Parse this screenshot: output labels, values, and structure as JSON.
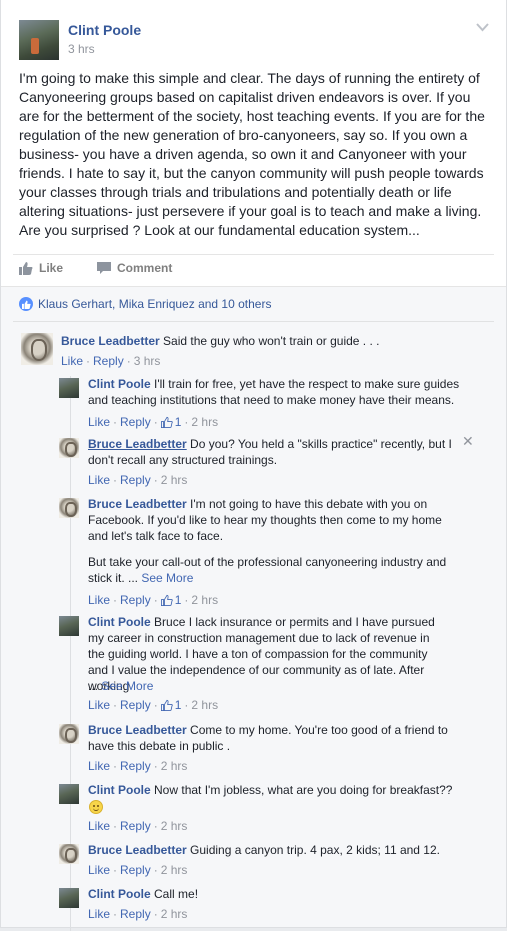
{
  "post": {
    "author": "Clint Poole",
    "time": "3 hrs",
    "text": "I'm going to make this simple and clear. The days of running the entirety of Canyoneering groups based on capitalist driven endeavors is over. If you are for the betterment of the society, host teaching events. If you are for the regulation of the new generation of bro-canyoneers, say so. If you own a business- you have a driven agenda, so own it and Canyoneer with your friends. I hate to say it, but the canyon community will push people towards your classes through trials and tribulations and potentially death or life altering situations- just persevere if your goal is to teach and make a living. Are you surprised ? Look at our fundamental education system..."
  },
  "actions": {
    "like": "Like",
    "comment": "Comment"
  },
  "likes_summary": "Klaus Gerhart, Mika Enriquez and 10 others",
  "labels": {
    "like": "Like",
    "reply": "Reply",
    "sep": "·",
    "see_more": "See More"
  },
  "comments": [
    {
      "name": "Bruce Leadbetter",
      "text": "Said the guy who won't train or guide . . .",
      "time": "3 hrs"
    },
    {
      "name": "Clint Poole",
      "text": "I'll train for free, yet have the respect to make sure guides and teaching institutions that need to make money have their means.",
      "likes": "1",
      "time": "2 hrs"
    },
    {
      "name": "Bruce Leadbetter",
      "text": "Do you? You held a \"skills practice\" recently, but I don't recall any structured trainings.",
      "time": "2 hrs"
    },
    {
      "name": "Bruce Leadbetter",
      "text": "I'm not going to have this debate with you on Facebook. If you'd like to hear my thoughts then come to my home and let's talk face to face.",
      "text2": "But take your call-out of the professional canyoneering industry and stick it. ...",
      "likes": "1",
      "time": "2 hrs"
    },
    {
      "name": "Clint Poole",
      "text": "Bruce I lack insurance or permits and I have pursued my career in construction management due to lack of revenue in the guiding world. I have a ton of compassion for the community and I value the independence of our community as of late. After working",
      "text2": "...",
      "likes": "1",
      "time": "2 hrs"
    },
    {
      "name": "Bruce Leadbetter",
      "text": "Come to my home. You're too good of a friend to have this debate in public .",
      "time": "2 hrs"
    },
    {
      "name": "Clint Poole",
      "text": "Now that I'm jobless, what are you doing for breakfast??",
      "time": "2 hrs"
    },
    {
      "name": "Bruce Leadbetter",
      "text": "Guiding a canyon trip. 4 pax, 2 kids; 11 and 12.",
      "time": "2 hrs"
    },
    {
      "name": "Clint Poole",
      "text": "Call me!",
      "time": "2 hrs"
    }
  ],
  "colors": {
    "link": "#365899",
    "meta": "#90949c",
    "action_link": "#4267b2",
    "feedback_bg": "#f6f7f9"
  }
}
